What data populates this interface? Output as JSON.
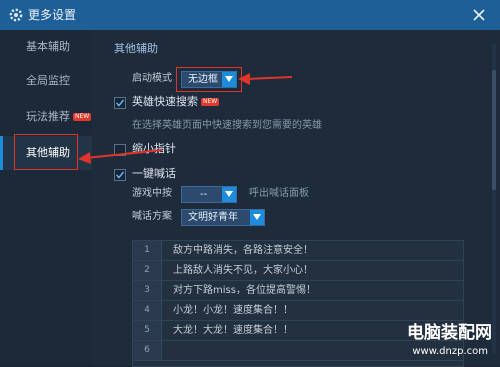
{
  "window": {
    "title": "更多设置",
    "icon": "gear-icon",
    "close_icon": "close-icon",
    "title_bar_color": "#1f5f97"
  },
  "sidebar": {
    "items": [
      {
        "label": "基本辅助"
      },
      {
        "label": "全局监控"
      },
      {
        "label": "玩法推荐",
        "badge": "NEW"
      },
      {
        "label": "其他辅助",
        "active": true
      }
    ]
  },
  "main": {
    "section_title": "其他辅助",
    "launch_mode": {
      "label": "启动模式",
      "value": "无边框"
    },
    "hero_search": {
      "label": "英雄快速搜索",
      "checked": true,
      "badge": "NEW",
      "hint": "在选择英雄页面中快速搜索到您需要的英雄"
    },
    "mini_pointer": {
      "label": "缩小指针",
      "checked": false
    },
    "one_key_shout": {
      "label": "一键喊话",
      "checked": true
    },
    "in_game_key": {
      "label": "游戏中按",
      "value": "--",
      "suffix": "呼出喊话面板"
    },
    "shout_scheme": {
      "label": "喊话方案",
      "value": "文明好青年"
    },
    "shout_list": [
      {
        "num": "1",
        "text": "敌方中路消失，各路注意安全！"
      },
      {
        "num": "2",
        "text": "上路敌人消失不见，大家小心！"
      },
      {
        "num": "3",
        "text": "对方下路miss，各位提高警惕！"
      },
      {
        "num": "4",
        "text": "小龙！小龙！速度集合！！"
      },
      {
        "num": "5",
        "text": "大龙！大龙！速度集合！！"
      },
      {
        "num": "6",
        "text": ""
      }
    ]
  },
  "watermark": {
    "line1": "电脑装配网",
    "line2": "www.dnzp.com"
  },
  "colors": {
    "accent": "#1e8cdc",
    "annotation_red": "#e0342a",
    "badge_red": "#e03a2c"
  }
}
